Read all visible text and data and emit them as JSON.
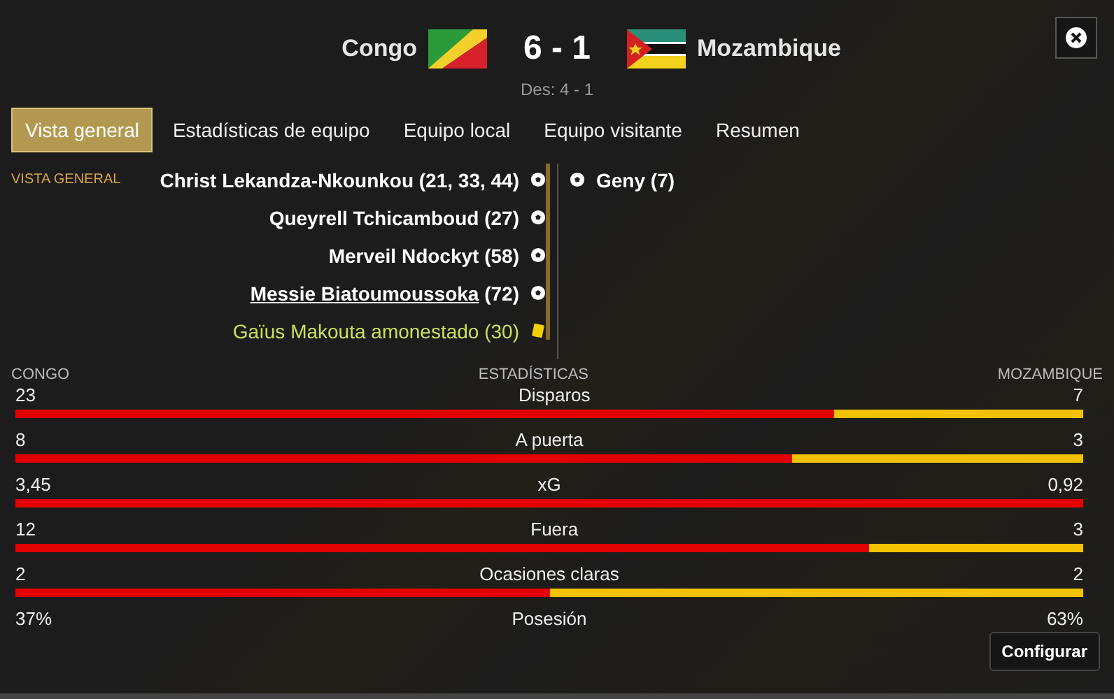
{
  "header": {
    "home": {
      "name": "Congo"
    },
    "score": "6 - 1",
    "away": {
      "name": "Mozambique"
    },
    "subscore": "Des: 4 - 1"
  },
  "tabs": [
    {
      "label": "Vista general",
      "selected": true
    },
    {
      "label": "Estadísticas de equipo",
      "selected": false
    },
    {
      "label": "Equipo local",
      "selected": false
    },
    {
      "label": "Equipo visitante",
      "selected": false
    },
    {
      "label": "Resumen",
      "selected": false
    }
  ],
  "section_label": "VISTA GENERAL",
  "home_events": [
    {
      "kind": "goal",
      "player": "Christ Lekandza-Nkounkou",
      "minute": "(21, 33, 44)",
      "underlined": false
    },
    {
      "kind": "goal",
      "player": "Queyrell Tchicamboud",
      "minute": "(27)",
      "underlined": false
    },
    {
      "kind": "goal",
      "player": "Merveil Ndockyt",
      "minute": "(58)",
      "underlined": false
    },
    {
      "kind": "goal",
      "player": "Messie Biatoumoussoka",
      "minute": "(72)",
      "underlined": true
    },
    {
      "kind": "yellow_card",
      "player": "Gaïus Makouta amonestado",
      "minute": "(30)",
      "underlined": false
    }
  ],
  "away_events": [
    {
      "kind": "goal",
      "player": "Geny",
      "minute": "(7)",
      "underlined": false
    }
  ],
  "stats": {
    "home_label": "CONGO",
    "title": "ESTADÍSTICAS",
    "away_label": "MOZAMBIQUE",
    "rows": [
      {
        "home": "23",
        "name": "Disparos",
        "away": "7",
        "level": 0.767
      },
      {
        "home": "8",
        "name": "A puerta",
        "away": "3",
        "level": 0.727
      },
      {
        "home": "3,45",
        "name": "xG",
        "away": "0,92",
        "level": 1
      },
      {
        "home": "12",
        "name": "Fuera",
        "away": "3",
        "level": 0.8
      },
      {
        "home": "2",
        "name": "Ocasiones claras",
        "away": "2",
        "level": 0.5
      },
      {
        "home": "37%",
        "name": "Posesión",
        "away": "63%"
      }
    ]
  },
  "configure_button": "Configurar"
}
